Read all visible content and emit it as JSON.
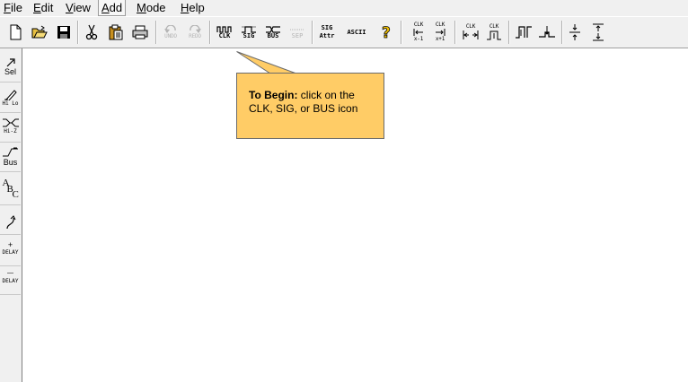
{
  "menu": {
    "items": [
      {
        "label": "File",
        "accel": "F",
        "rest": "ile"
      },
      {
        "label": "Edit",
        "accel": "E",
        "rest": "dit"
      },
      {
        "label": "View",
        "accel": "V",
        "rest": "iew"
      },
      {
        "label": "Add",
        "accel": "A",
        "rest": "dd"
      },
      {
        "label": "Mode",
        "accel": "M",
        "rest": "ode"
      },
      {
        "label": "Help",
        "accel": "H",
        "rest": "elp"
      }
    ]
  },
  "toolbar": {
    "undo_label": "UNDO",
    "redo_label": "REDO",
    "clk_label": "CLK",
    "sig_label": "SIG",
    "bus_label": "BUS",
    "sep_label": "SEP",
    "sig_attr_line1": "SIG",
    "sig_attr_line2": "Attr",
    "ascii_label": "ASCII",
    "clk_shift_left_top": "CLK",
    "clk_shift_left_bottom": "x-1",
    "clk_shift_right_top": "CLK",
    "clk_shift_right_bottom": "x+1",
    "clk_widen_top": "CLK",
    "clk_narrow_top": "CLK"
  },
  "palette": {
    "select_label": "Sel",
    "hilo_label": "Hi Lo",
    "hiz_label": "Hi-Z",
    "bus_label": "Bus",
    "text_a": "A",
    "text_b": "B",
    "text_c": "C",
    "add_delay_sign": "+",
    "add_delay_label": "DELAY",
    "remove_delay_sign": "—",
    "remove_delay_label": "DELAY"
  },
  "callout": {
    "bold": "To Begin:",
    "text": " click on the CLK, SIG, or BUS icon"
  },
  "colors": {
    "callout_bg": "#ffcc66",
    "chrome_bg": "#f0f0f0",
    "canvas_bg": "#ffffff"
  }
}
